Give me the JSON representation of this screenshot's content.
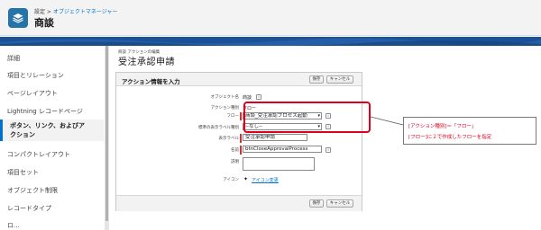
{
  "header": {
    "breadcrumb_prefix": "設定 > ",
    "breadcrumb_link": "オブジェクトマネージャー",
    "title": "商談"
  },
  "sidebar": {
    "items": [
      {
        "label": "詳細"
      },
      {
        "label": "項目とリレーション"
      },
      {
        "label": "ページレイアウト"
      },
      {
        "label": "Lightning レコードページ"
      },
      {
        "label": "ボタン、リンク、およびア"
      },
      {
        "label": "クション"
      },
      {
        "label": "コンパクトレイアウト"
      },
      {
        "label": "項目セット"
      },
      {
        "label": "オブジェクト制限"
      },
      {
        "label": "レコードタイプ"
      },
      {
        "label": "ロ..."
      }
    ]
  },
  "main": {
    "sub_breadcrumb": "商談 アクションの編集",
    "title": "受注承認申請"
  },
  "panel": {
    "title": "アクション情報を入力",
    "save_label": "保存",
    "cancel_label": "キャンセル",
    "info_glyph": "i",
    "fields": {
      "object_name_label": "オブジェクト名",
      "object_name_value": "商談",
      "action_type_label": "アクション種別",
      "action_type_value": "フロー",
      "flow_label": "フロー",
      "flow_value": "商談_受注承認プロセス起動",
      "label_display_label": "標準の表示ラベル種別",
      "label_display_value": "--なし--",
      "display_label_label": "表示ラベル",
      "display_label_value": "受注承認申請",
      "api_name_label": "名前",
      "api_name_value": "btnCloseApprovalProcess",
      "description_label": "説明",
      "icon_label": "アイコン",
      "icon_link": "アイコン変更"
    }
  },
  "callout": {
    "line1": "[アクション種別]＝「フロー」",
    "line2": "[フロー]に２で作成したフローを指定"
  },
  "colors": {
    "accent": "#0070d2",
    "highlight": "#e0001b",
    "brand_band": "#1b5297"
  }
}
